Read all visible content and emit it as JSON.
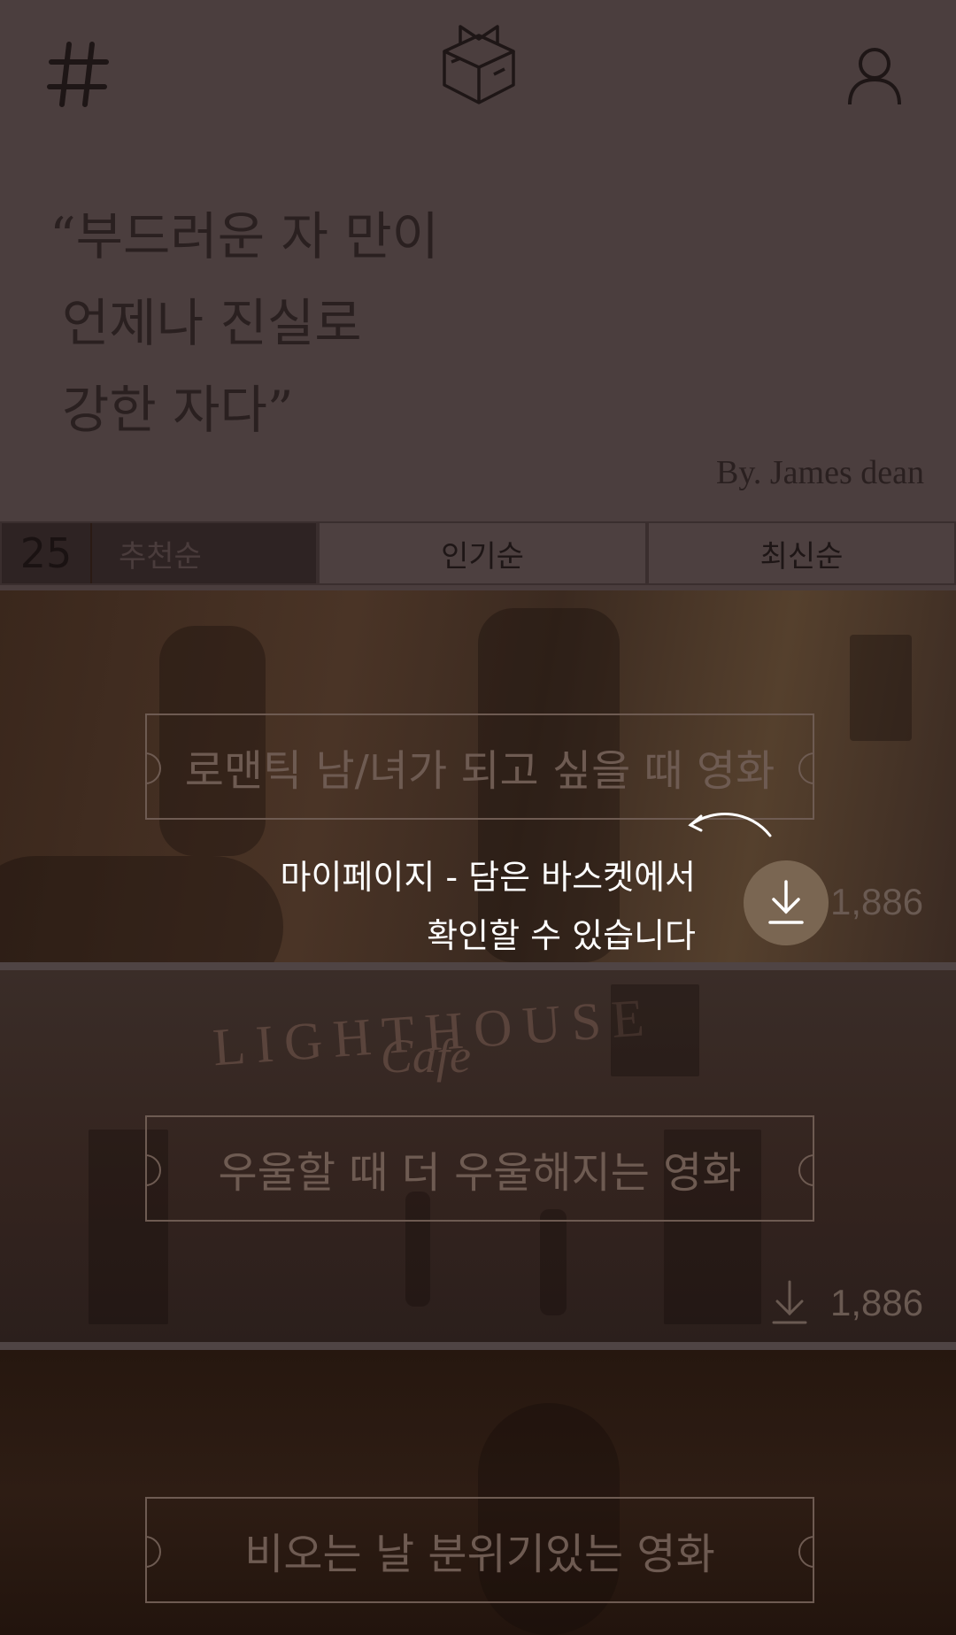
{
  "quote": {
    "line1": "“부드러운 자 만이",
    "line2": "언제나 진실로",
    "line3": "강한 자다”",
    "author": "By. James dean"
  },
  "tabs": {
    "count": "25",
    "items": [
      {
        "label": "추천순"
      },
      {
        "label": "인기순"
      },
      {
        "label": "최신순"
      }
    ]
  },
  "cards": [
    {
      "title": "로맨틱 남/녀가 되고 싶을 때 영화",
      "downloads": "1,886"
    },
    {
      "title": "우울할 때 더 우울해지는 영화",
      "downloads": "1,886",
      "sign": "LIGHTHOUSE",
      "sign_script": "Cafe"
    },
    {
      "title": "비오는 날 분위기있는 영화"
    }
  ],
  "tooltip": {
    "line1": "마이페이지 - 담은 바스켓에서",
    "line2": "확인할 수 있습니다"
  },
  "colors": {
    "overlay": "#4a3d3d",
    "ticket_border": "#6e5b52",
    "tooltip_text": "#ffffff"
  },
  "icons": {
    "menu": "hash-icon",
    "logo": "box-logo-icon",
    "profile": "user-icon",
    "download": "download-icon",
    "hint_arrow": "curved-arrow-icon"
  }
}
